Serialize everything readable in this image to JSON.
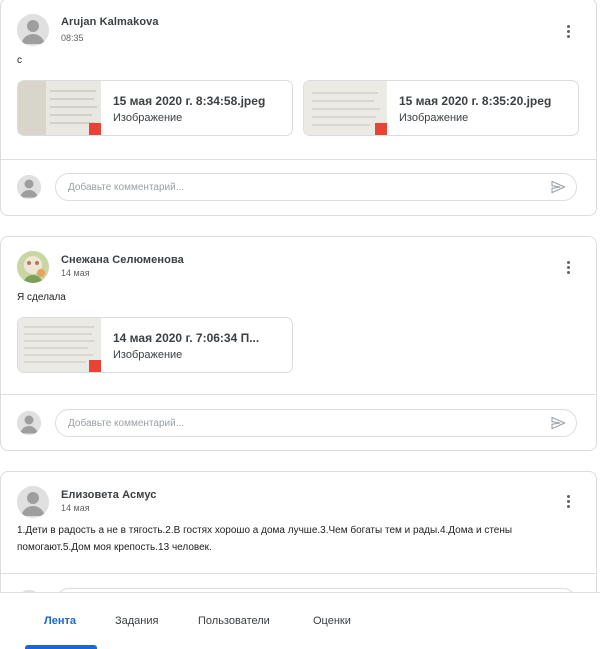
{
  "feed": {
    "comment_placeholder": "Добавьте комментарий...",
    "posts": [
      {
        "author": "Arujan Kalmakova",
        "time": "08:35",
        "text": "с",
        "attachments": [
          {
            "title": "15 мая 2020 г. 8:34:58.jpeg",
            "type": "Изображение"
          },
          {
            "title": "15 мая 2020 г. 8:35:20.jpeg",
            "type": "Изображение"
          }
        ]
      },
      {
        "author": "Снежана Селюменова",
        "time": "14 мая",
        "text": "Я сделала",
        "attachments": [
          {
            "title": "14 мая 2020 г. 7:06:34 П...",
            "type": "Изображение"
          }
        ]
      },
      {
        "author": "Елизовета Асмус",
        "time": "14 мая",
        "text_line1": "1.Дети в радость а не в тягость.2.В гостях хорошо а дома лучше.3.Чем богаты тем и рады.4.Дома и стены",
        "text_line2": "помогают.5.Дом моя крепость.13 человек."
      }
    ]
  },
  "nav": {
    "tabs": [
      "Лента",
      "Задания",
      "Пользователи",
      "Оценки"
    ],
    "active": "Лента"
  },
  "colors": {
    "accent": "#1967d2",
    "border": "#dadce0",
    "file_badge": "#ea4335"
  }
}
